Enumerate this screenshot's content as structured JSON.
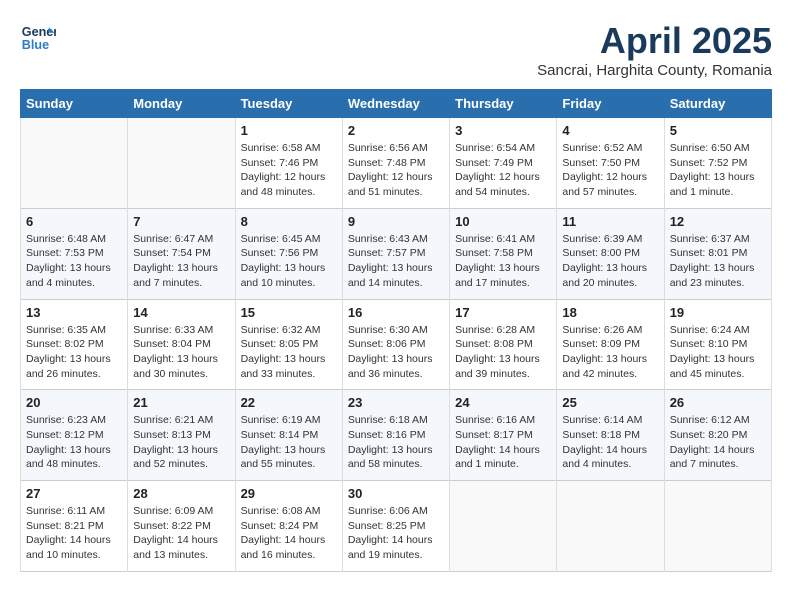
{
  "logo": {
    "line1": "General",
    "line2": "Blue"
  },
  "title": "April 2025",
  "subtitle": "Sancrai, Harghita County, Romania",
  "weekdays": [
    "Sunday",
    "Monday",
    "Tuesday",
    "Wednesday",
    "Thursday",
    "Friday",
    "Saturday"
  ],
  "weeks": [
    [
      {
        "day": "",
        "sunrise": "",
        "sunset": "",
        "daylight": ""
      },
      {
        "day": "",
        "sunrise": "",
        "sunset": "",
        "daylight": ""
      },
      {
        "day": "1",
        "sunrise": "Sunrise: 6:58 AM",
        "sunset": "Sunset: 7:46 PM",
        "daylight": "Daylight: 12 hours and 48 minutes."
      },
      {
        "day": "2",
        "sunrise": "Sunrise: 6:56 AM",
        "sunset": "Sunset: 7:48 PM",
        "daylight": "Daylight: 12 hours and 51 minutes."
      },
      {
        "day": "3",
        "sunrise": "Sunrise: 6:54 AM",
        "sunset": "Sunset: 7:49 PM",
        "daylight": "Daylight: 12 hours and 54 minutes."
      },
      {
        "day": "4",
        "sunrise": "Sunrise: 6:52 AM",
        "sunset": "Sunset: 7:50 PM",
        "daylight": "Daylight: 12 hours and 57 minutes."
      },
      {
        "day": "5",
        "sunrise": "Sunrise: 6:50 AM",
        "sunset": "Sunset: 7:52 PM",
        "daylight": "Daylight: 13 hours and 1 minute."
      }
    ],
    [
      {
        "day": "6",
        "sunrise": "Sunrise: 6:48 AM",
        "sunset": "Sunset: 7:53 PM",
        "daylight": "Daylight: 13 hours and 4 minutes."
      },
      {
        "day": "7",
        "sunrise": "Sunrise: 6:47 AM",
        "sunset": "Sunset: 7:54 PM",
        "daylight": "Daylight: 13 hours and 7 minutes."
      },
      {
        "day": "8",
        "sunrise": "Sunrise: 6:45 AM",
        "sunset": "Sunset: 7:56 PM",
        "daylight": "Daylight: 13 hours and 10 minutes."
      },
      {
        "day": "9",
        "sunrise": "Sunrise: 6:43 AM",
        "sunset": "Sunset: 7:57 PM",
        "daylight": "Daylight: 13 hours and 14 minutes."
      },
      {
        "day": "10",
        "sunrise": "Sunrise: 6:41 AM",
        "sunset": "Sunset: 7:58 PM",
        "daylight": "Daylight: 13 hours and 17 minutes."
      },
      {
        "day": "11",
        "sunrise": "Sunrise: 6:39 AM",
        "sunset": "Sunset: 8:00 PM",
        "daylight": "Daylight: 13 hours and 20 minutes."
      },
      {
        "day": "12",
        "sunrise": "Sunrise: 6:37 AM",
        "sunset": "Sunset: 8:01 PM",
        "daylight": "Daylight: 13 hours and 23 minutes."
      }
    ],
    [
      {
        "day": "13",
        "sunrise": "Sunrise: 6:35 AM",
        "sunset": "Sunset: 8:02 PM",
        "daylight": "Daylight: 13 hours and 26 minutes."
      },
      {
        "day": "14",
        "sunrise": "Sunrise: 6:33 AM",
        "sunset": "Sunset: 8:04 PM",
        "daylight": "Daylight: 13 hours and 30 minutes."
      },
      {
        "day": "15",
        "sunrise": "Sunrise: 6:32 AM",
        "sunset": "Sunset: 8:05 PM",
        "daylight": "Daylight: 13 hours and 33 minutes."
      },
      {
        "day": "16",
        "sunrise": "Sunrise: 6:30 AM",
        "sunset": "Sunset: 8:06 PM",
        "daylight": "Daylight: 13 hours and 36 minutes."
      },
      {
        "day": "17",
        "sunrise": "Sunrise: 6:28 AM",
        "sunset": "Sunset: 8:08 PM",
        "daylight": "Daylight: 13 hours and 39 minutes."
      },
      {
        "day": "18",
        "sunrise": "Sunrise: 6:26 AM",
        "sunset": "Sunset: 8:09 PM",
        "daylight": "Daylight: 13 hours and 42 minutes."
      },
      {
        "day": "19",
        "sunrise": "Sunrise: 6:24 AM",
        "sunset": "Sunset: 8:10 PM",
        "daylight": "Daylight: 13 hours and 45 minutes."
      }
    ],
    [
      {
        "day": "20",
        "sunrise": "Sunrise: 6:23 AM",
        "sunset": "Sunset: 8:12 PM",
        "daylight": "Daylight: 13 hours and 48 minutes."
      },
      {
        "day": "21",
        "sunrise": "Sunrise: 6:21 AM",
        "sunset": "Sunset: 8:13 PM",
        "daylight": "Daylight: 13 hours and 52 minutes."
      },
      {
        "day": "22",
        "sunrise": "Sunrise: 6:19 AM",
        "sunset": "Sunset: 8:14 PM",
        "daylight": "Daylight: 13 hours and 55 minutes."
      },
      {
        "day": "23",
        "sunrise": "Sunrise: 6:18 AM",
        "sunset": "Sunset: 8:16 PM",
        "daylight": "Daylight: 13 hours and 58 minutes."
      },
      {
        "day": "24",
        "sunrise": "Sunrise: 6:16 AM",
        "sunset": "Sunset: 8:17 PM",
        "daylight": "Daylight: 14 hours and 1 minute."
      },
      {
        "day": "25",
        "sunrise": "Sunrise: 6:14 AM",
        "sunset": "Sunset: 8:18 PM",
        "daylight": "Daylight: 14 hours and 4 minutes."
      },
      {
        "day": "26",
        "sunrise": "Sunrise: 6:12 AM",
        "sunset": "Sunset: 8:20 PM",
        "daylight": "Daylight: 14 hours and 7 minutes."
      }
    ],
    [
      {
        "day": "27",
        "sunrise": "Sunrise: 6:11 AM",
        "sunset": "Sunset: 8:21 PM",
        "daylight": "Daylight: 14 hours and 10 minutes."
      },
      {
        "day": "28",
        "sunrise": "Sunrise: 6:09 AM",
        "sunset": "Sunset: 8:22 PM",
        "daylight": "Daylight: 14 hours and 13 minutes."
      },
      {
        "day": "29",
        "sunrise": "Sunrise: 6:08 AM",
        "sunset": "Sunset: 8:24 PM",
        "daylight": "Daylight: 14 hours and 16 minutes."
      },
      {
        "day": "30",
        "sunrise": "Sunrise: 6:06 AM",
        "sunset": "Sunset: 8:25 PM",
        "daylight": "Daylight: 14 hours and 19 minutes."
      },
      {
        "day": "",
        "sunrise": "",
        "sunset": "",
        "daylight": ""
      },
      {
        "day": "",
        "sunrise": "",
        "sunset": "",
        "daylight": ""
      },
      {
        "day": "",
        "sunrise": "",
        "sunset": "",
        "daylight": ""
      }
    ]
  ]
}
